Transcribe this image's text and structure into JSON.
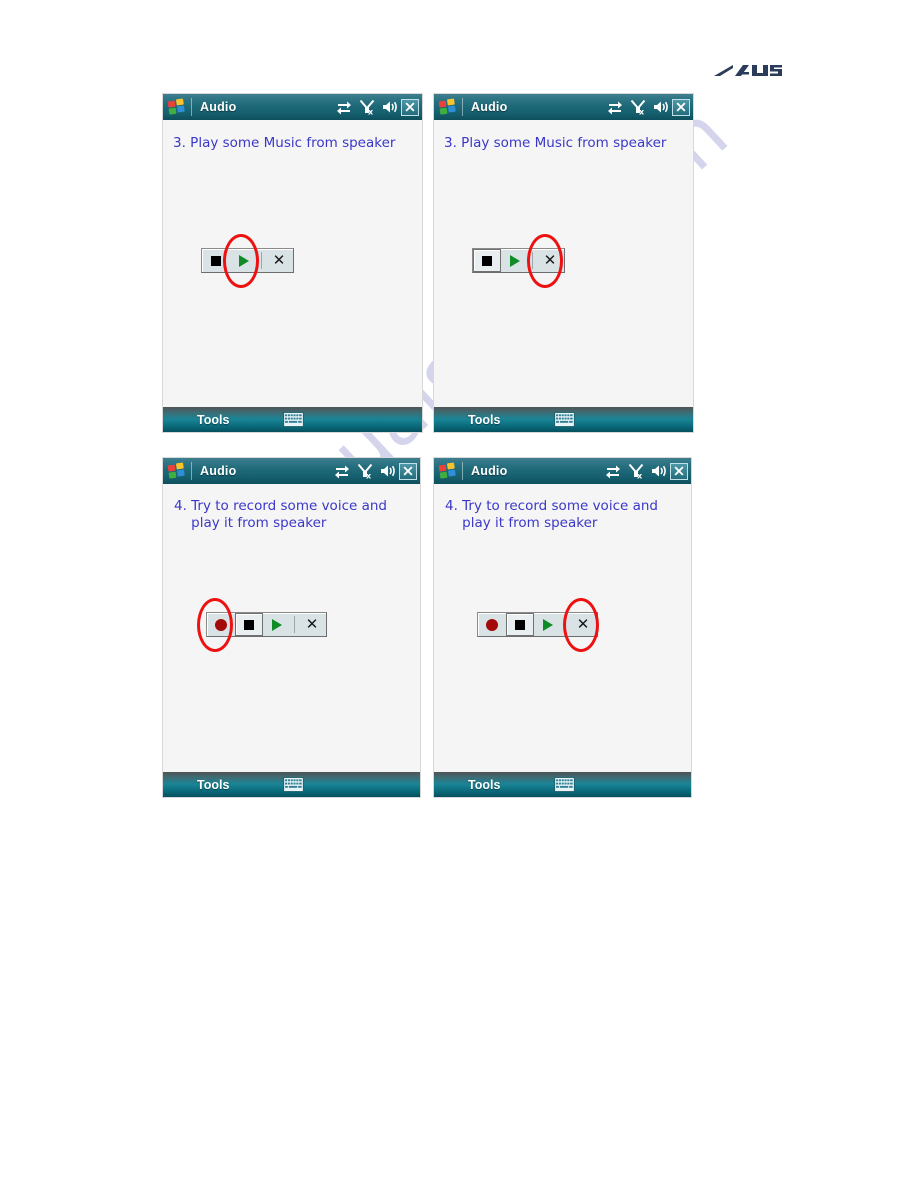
{
  "brand": {
    "logo_text": "ASUS",
    "logo_color": "#2b3c5a"
  },
  "watermark": {
    "text": "manualshive.com",
    "color": "#9a9ad4"
  },
  "colors": {
    "titlebar_teal": "#16606f",
    "bottombar_teal": "#1a8596",
    "instruction_blue": "#3b38c8",
    "highlight_red": "#ee1111",
    "play_green": "#0f8c26",
    "record_red": "#a30b0b",
    "stop_black": "#000000"
  },
  "panels": [
    {
      "id": "panel-1",
      "title": "Audio",
      "instruction": "3. Play some Music from speaker",
      "statusbar_icons": [
        "connectivity-icon",
        "signal-off-icon",
        "volume-icon"
      ],
      "close_label": "✕",
      "controls": [
        {
          "name": "stop-button",
          "icon": "stop-icon",
          "pressed": false,
          "highlighted": false
        },
        {
          "name": "play-button",
          "icon": "play-icon",
          "pressed": false,
          "highlighted": true
        },
        {
          "name": "close-button",
          "icon": "close-icon",
          "pressed": false,
          "highlighted": false,
          "label": "✕"
        }
      ],
      "bottom": {
        "tools_label": "Tools",
        "keyboard_icon": "keyboard-icon"
      }
    },
    {
      "id": "panel-2",
      "title": "Audio",
      "instruction": "3. Play some Music from speaker",
      "statusbar_icons": [
        "connectivity-icon",
        "signal-off-icon",
        "volume-icon"
      ],
      "close_label": "✕",
      "controls": [
        {
          "name": "stop-button",
          "icon": "stop-icon",
          "pressed": true,
          "highlighted": false
        },
        {
          "name": "play-button",
          "icon": "play-icon",
          "pressed": false,
          "highlighted": false
        },
        {
          "name": "close-button",
          "icon": "close-icon",
          "pressed": false,
          "highlighted": true,
          "label": "✕"
        }
      ],
      "bottom": {
        "tools_label": "Tools",
        "keyboard_icon": "keyboard-icon"
      }
    },
    {
      "id": "panel-3",
      "title": "Audio",
      "instruction": "4. Try to record some voice and\n    play it from speaker",
      "statusbar_icons": [
        "connectivity-icon",
        "signal-off-icon",
        "volume-icon"
      ],
      "close_label": "✕",
      "controls": [
        {
          "name": "record-button",
          "icon": "record-icon",
          "pressed": false,
          "highlighted": true
        },
        {
          "name": "stop-button",
          "icon": "stop-icon",
          "pressed": true,
          "highlighted": false
        },
        {
          "name": "play-button",
          "icon": "play-icon",
          "pressed": false,
          "highlighted": false
        },
        {
          "name": "close-button",
          "icon": "close-icon",
          "pressed": false,
          "highlighted": false,
          "label": "✕"
        }
      ],
      "bottom": {
        "tools_label": "Tools",
        "keyboard_icon": "keyboard-icon"
      }
    },
    {
      "id": "panel-4",
      "title": "Audio",
      "instruction": "4. Try to record some voice and\n    play it from speaker",
      "statusbar_icons": [
        "connectivity-icon",
        "signal-off-icon",
        "volume-icon"
      ],
      "close_label": "✕",
      "controls": [
        {
          "name": "record-button",
          "icon": "record-icon",
          "pressed": false,
          "highlighted": false
        },
        {
          "name": "stop-button",
          "icon": "stop-icon",
          "pressed": true,
          "highlighted": false
        },
        {
          "name": "play-button",
          "icon": "play-icon",
          "pressed": false,
          "highlighted": false
        },
        {
          "name": "close-button",
          "icon": "close-icon",
          "pressed": false,
          "highlighted": true,
          "label": "✕"
        }
      ],
      "bottom": {
        "tools_label": "Tools",
        "keyboard_icon": "keyboard-icon"
      }
    }
  ]
}
